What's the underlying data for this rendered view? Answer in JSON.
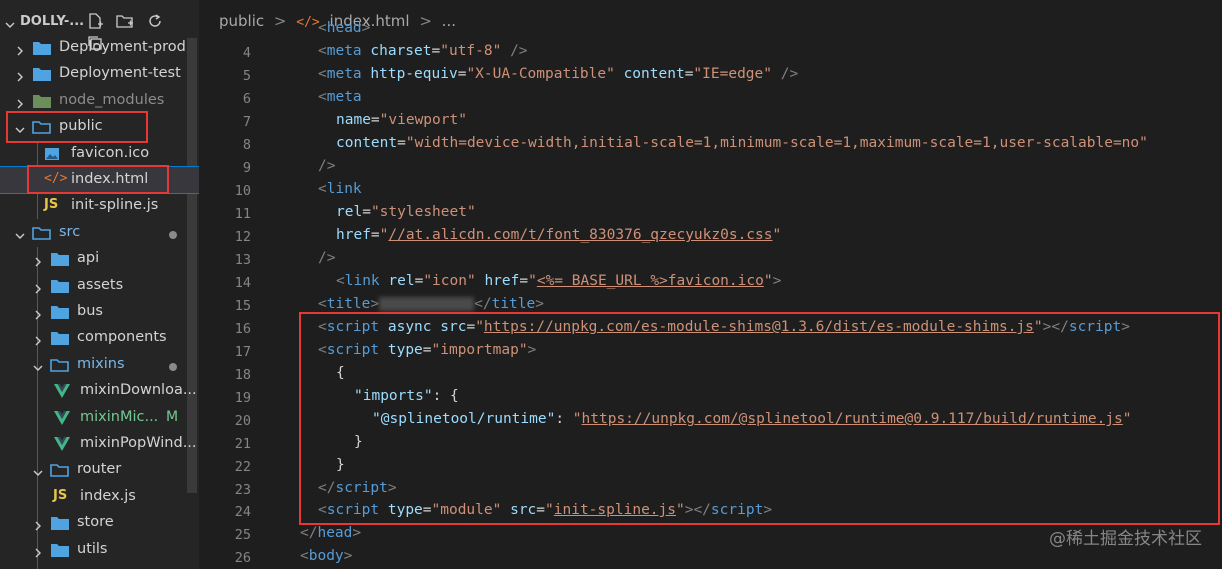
{
  "explorer": {
    "title": "DOLLY-...",
    "items": [
      {
        "label": "Deployment-prod",
        "kind": "folder",
        "open": false
      },
      {
        "label": "Deployment-test",
        "kind": "folder",
        "open": false
      },
      {
        "label": "node_modules",
        "kind": "folder-modules",
        "open": false
      },
      {
        "label": "public",
        "kind": "folder",
        "open": true
      },
      {
        "label": "favicon.ico",
        "kind": "image-file"
      },
      {
        "label": "index.html",
        "kind": "html-file",
        "selected": true
      },
      {
        "label": "init-spline.js",
        "kind": "js-file"
      },
      {
        "label": "src",
        "kind": "folder",
        "open": true
      },
      {
        "label": "api",
        "kind": "folder",
        "open": false
      },
      {
        "label": "assets",
        "kind": "folder",
        "open": false
      },
      {
        "label": "bus",
        "kind": "folder",
        "open": false
      },
      {
        "label": "components",
        "kind": "folder",
        "open": false
      },
      {
        "label": "mixins",
        "kind": "folder",
        "open": true
      },
      {
        "label": "mixinDownloa...",
        "kind": "vue-file"
      },
      {
        "label": "mixinMic...",
        "kind": "vue-file",
        "badge": "M"
      },
      {
        "label": "mixinPopWind...",
        "kind": "vue-file"
      },
      {
        "label": "router",
        "kind": "folder",
        "open": true
      },
      {
        "label": "index.js",
        "kind": "js-file"
      },
      {
        "label": "store",
        "kind": "folder",
        "open": false
      },
      {
        "label": "utils",
        "kind": "folder",
        "open": false
      }
    ]
  },
  "breadcrumb": {
    "folder": "public",
    "sep": ">",
    "file": "index.html",
    "more": "..."
  },
  "code": {
    "line_numbers": [
      "4",
      "5",
      "6",
      "7",
      "8",
      "9",
      "10",
      "11",
      "12",
      "13",
      "14",
      "15",
      "16",
      "17",
      "18",
      "19",
      "20",
      "21",
      "22",
      "23",
      "24",
      "25",
      "26"
    ],
    "l4": {
      "open": "<",
      "tag": "meta",
      "attr": "charset",
      "eq": "=",
      "val": "\"utf-8\"",
      "close": " />"
    },
    "l5": {
      "open": "<",
      "tag": "meta",
      "a1": "http-equiv",
      "v1": "\"X-UA-Compatible\"",
      "a2": "content",
      "v2": "\"IE=edge\"",
      "close": " />"
    },
    "l6": {
      "open": "<",
      "tag": "meta"
    },
    "l7": {
      "attr": "name",
      "val": "\"viewport\""
    },
    "l8": {
      "attr": "content",
      "val": "\"width=device-width,initial-scale=1,minimum-scale=1,maximum-scale=1,user-scalable=no\""
    },
    "l9": {
      "text": "/>"
    },
    "l10": {
      "open": "<",
      "tag": "link"
    },
    "l11": {
      "attr": "rel",
      "val": "\"stylesheet\""
    },
    "l12": {
      "attr": "href",
      "q": "\"",
      "url": "//at.alicdn.com/t/font_830376_qzecyukz0s.css"
    },
    "l13": {
      "text": "/>"
    },
    "l14": {
      "open": "<",
      "tag": "link",
      "a1": "rel",
      "v1": "\"icon\"",
      "a2": "href",
      "q": "\"",
      "v2": "<%= BASE_URL %>favicon.ico",
      "close": ">"
    },
    "l15": {
      "open": "<",
      "tag": "title",
      "end": "</",
      "end_tag": "title"
    },
    "l16": {
      "open": "<",
      "tag": "script",
      "kw": "async",
      "attr": "src",
      "q": "\"",
      "url": "https://unpkg.com/es-module-shims@1.3.6/dist/es-module-shims.js",
      "end": "></",
      "end_tag": "script"
    },
    "l17": {
      "open": "<",
      "tag": "script",
      "attr": "type",
      "val": "\"importmap\""
    },
    "l18": {
      "text": "{"
    },
    "l19": {
      "key": "\"imports\"",
      "rest": ": {"
    },
    "l20": {
      "key": "\"@splinetool/runtime\"",
      "colon": ": ",
      "q": "\"",
      "url": "https://unpkg.com/@splinetool/runtime@0.9.117/build/runtime.js"
    },
    "l21": {
      "text": "}"
    },
    "l22": {
      "text": "}"
    },
    "l23": {
      "open": "</",
      "tag": "script"
    },
    "l24": {
      "open": "<",
      "tag": "script",
      "attr": "type",
      "val": "\"module\"",
      "a2": "src",
      "q": "\"",
      "v2": "init-spline.js",
      "end": "></",
      "end_tag": "script"
    },
    "l25": {
      "open": "</",
      "tag": "head"
    },
    "l26": {
      "open": "<",
      "tag": "body"
    }
  },
  "watermark": "@稀土掘金技术社区",
  "colors": {
    "highlight_box": "#e53935",
    "tag": "#569cd6",
    "attr": "#9cdcfe",
    "string": "#ce9178",
    "folder": "#4fa3e0",
    "vue": "#42b883",
    "js": "#e8c547",
    "html": "#e37933"
  }
}
